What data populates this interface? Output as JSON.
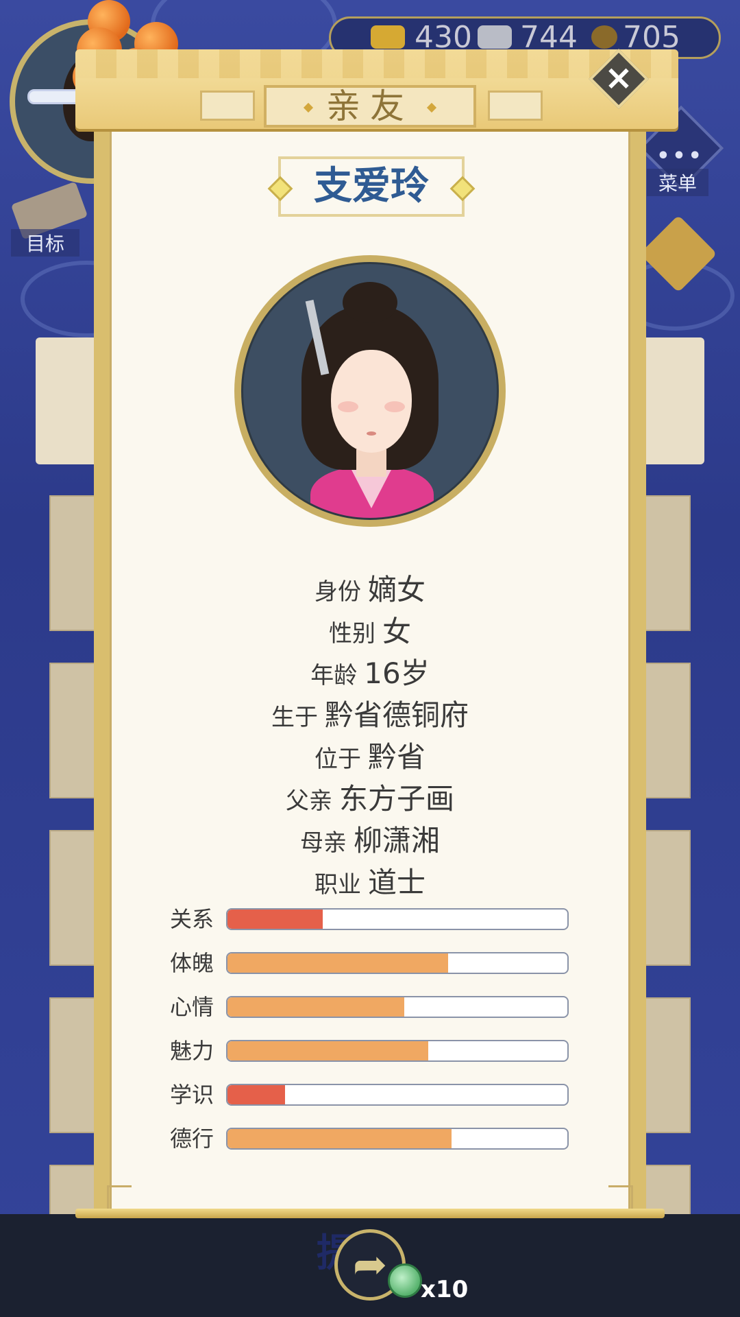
{
  "hud": {
    "gold": "430",
    "silver": "744",
    "coins": "705",
    "menu_label": "菜单",
    "target_label": "目标"
  },
  "dialog": {
    "title": "亲友",
    "close_symbol": "×",
    "person_name": "支爱玲",
    "info": [
      {
        "label": "身份",
        "value": "嫡女"
      },
      {
        "label": "性别",
        "value": "女"
      },
      {
        "label": "年龄",
        "value": "16岁"
      },
      {
        "label": "生于",
        "value": "黔省德铜府"
      },
      {
        "label": "位于",
        "value": "黔省"
      },
      {
        "label": "父亲",
        "value": "东方子画"
      },
      {
        "label": "母亲",
        "value": "柳潇湘"
      },
      {
        "label": "职业",
        "value": "道士"
      }
    ],
    "stats": [
      {
        "label": "关系",
        "level": 0.28,
        "color": "#e5604a"
      },
      {
        "label": "体魄",
        "level": 0.65,
        "color": "#f0a862"
      },
      {
        "label": "心情",
        "level": 0.52,
        "color": "#f0a862"
      },
      {
        "label": "魅力",
        "level": 0.59,
        "color": "#f0a862"
      },
      {
        "label": "学识",
        "level": 0.17,
        "color": "#e5604a"
      },
      {
        "label": "德行",
        "level": 0.66,
        "color": "#f0a862"
      }
    ]
  },
  "bottom": {
    "share_symbol": "➦",
    "jade_count": "x10",
    "partial_title": "提亲"
  }
}
